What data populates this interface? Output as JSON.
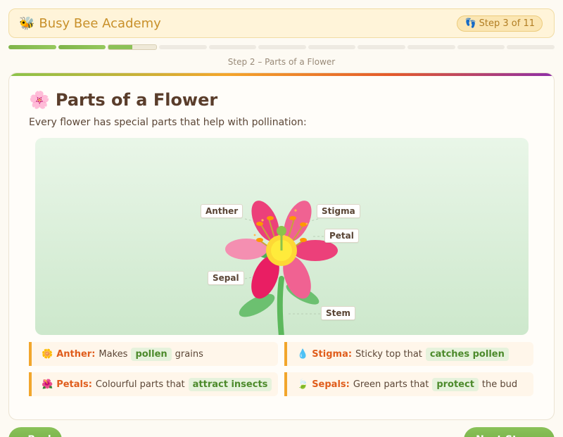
{
  "header": {
    "brand_icon": "bee-icon",
    "brand_name": "Busy Bee Academy",
    "step_icon": "footprints-icon",
    "step_label": "Step 3 of 11"
  },
  "progress": {
    "total_steps": 11,
    "completed_steps": 2,
    "current_step_fill": 0.5
  },
  "step_caption": "Step 2 – Parts of a Flower",
  "lesson": {
    "title_icon": "flower-icon",
    "title": "Parts of a Flower",
    "intro": "Every flower has special parts that help with pollination:"
  },
  "diagram": {
    "labels": {
      "anther": "Anther",
      "stigma": "Stigma",
      "petal": "Petal",
      "sepal": "Sepal",
      "stem": "Stem"
    }
  },
  "facts": [
    {
      "icon": "pollen-icon",
      "term": "Anther:",
      "before": "Makes",
      "highlight": "pollen",
      "after": "grains"
    },
    {
      "icon": "drop-icon",
      "term": "Stigma:",
      "before": "Sticky top that",
      "highlight": "catches pollen",
      "after": ""
    },
    {
      "icon": "petal-icon",
      "term": "Petals:",
      "before": "Colourful parts that",
      "highlight": "attract insects",
      "after": ""
    },
    {
      "icon": "leaf-icon",
      "term": "Sepals:",
      "before": "Green parts that",
      "highlight": "protect",
      "after": "the bud"
    }
  ],
  "nav": {
    "back_label": "← Back",
    "next_label": "Next Step →"
  },
  "colors": {
    "accent_orange": "#f2a62c",
    "accent_green": "#7fb44a",
    "brand_gold": "#c8902a"
  }
}
